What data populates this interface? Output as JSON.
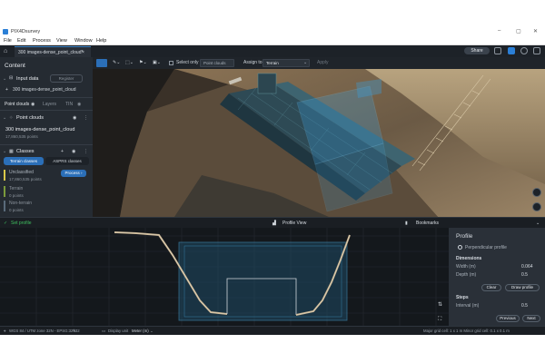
{
  "window": {
    "title": "PIX4Dsurvey",
    "controls": [
      "–",
      "▢",
      "✕"
    ]
  },
  "menu": [
    "File",
    "Edit",
    "Process",
    "View",
    "Window",
    "Help"
  ],
  "tabs": [
    {
      "label": "300 images-dense_point_cloud*",
      "close": "×"
    }
  ],
  "topbar": {
    "share_label": "Share"
  },
  "left_panel": {
    "content_title": "Content",
    "input_data": {
      "label": "Input data",
      "action": "Register",
      "item": "300 images-dense_point_cloud"
    },
    "view_tabs": [
      "Point clouds",
      "Layers",
      "TIN"
    ],
    "point_clouds": {
      "label": "Point clouds",
      "name": "300 images-dense_point_cloud",
      "count": "17,860,535 points"
    },
    "classes": {
      "label": "Classes",
      "tabs": [
        "Terrain classes",
        "ASPRS classes"
      ],
      "items": [
        {
          "name": "Unclassified",
          "count": "17,860,535 points",
          "action": "Process"
        },
        {
          "name": "Terrain",
          "count": "0 points"
        },
        {
          "name": "Non-terrain",
          "count": "0 points"
        }
      ]
    }
  },
  "viewport": {
    "select_only_label": "Select only",
    "point_clouds_placeholder": "Point clouds",
    "assign_to_label": "Assign to",
    "assign_value": "Terrain",
    "apply_label": "Apply"
  },
  "profile_bar": {
    "status": "Set profile",
    "profile_view": "Profile View",
    "bookmarks": "Bookmarks"
  },
  "profile_panel": {
    "title": "Profile",
    "option": "Perpendicular profile",
    "dimensions_title": "Dimensions",
    "width_label": "Width (m)",
    "width_value": "0.064",
    "depth_label": "Depth (m)",
    "depth_value": "0.5",
    "clear_label": "Clear",
    "draw_label": "Draw profile",
    "steps_title": "Steps",
    "interval_label": "Interval (m)",
    "interval_value": "0.5",
    "previous_label": "Previous",
    "next_label": "Next"
  },
  "status_bar": {
    "crs": "WGS 84 / UTM zone 32N - EPSG:32632",
    "display_unit_label": "Display unit",
    "display_unit_value": "Meter (m)",
    "grid_info": "Major grid cell: 1 x 1 m   Minor grid cell: 0.1 x 0.1 m"
  },
  "colors": {
    "accent": "#2b7fd6",
    "panel": "#252b32",
    "status_green": "#3fbf5f",
    "selection_blue": "#3aa0e0"
  }
}
